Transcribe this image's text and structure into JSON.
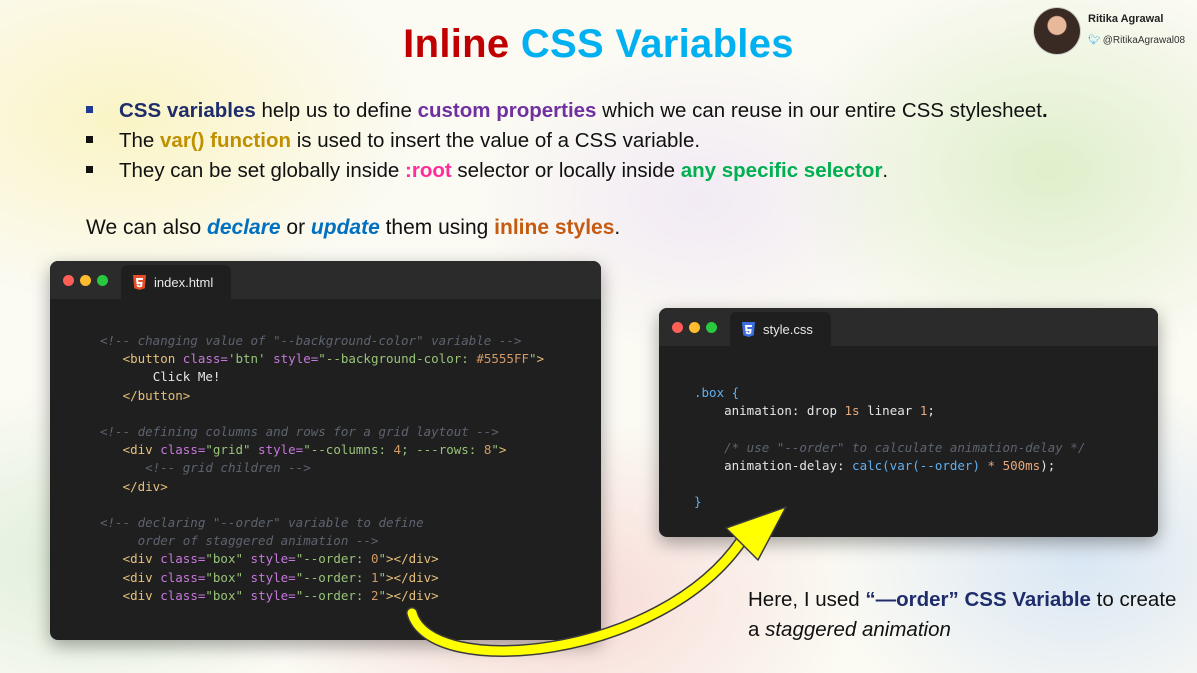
{
  "title": {
    "part1": "Inline",
    "part2": "CSS Variables"
  },
  "author": {
    "name": "Ritika Agrawal",
    "handle": "@RitikaAgrawal08",
    "avatar": "avatar-photo",
    "twitter_icon": "twitter-bird-icon"
  },
  "bullets": [
    {
      "b1": "CSS variables",
      "t1": " help us to define ",
      "b2": "custom properties",
      "t2": " which we can reuse in our entire CSS stylesheet",
      "end": "."
    },
    {
      "t0": "The ",
      "b1": "var() function",
      "t1": " is used to insert the value of a CSS variable."
    },
    {
      "t0": "They can be set globally inside ",
      "b1": ":root",
      "t1": " selector or locally inside ",
      "b2": "any specific selector",
      "t2": "."
    }
  ],
  "intro": {
    "t0": "We can also ",
    "e1": "declare",
    "t1": " or ",
    "e2": "update",
    "t2": " them using ",
    "b1": "inline styles",
    "end": "."
  },
  "html_window": {
    "filename": "index.html",
    "icon": "html5-icon",
    "lines": {
      "c1": "<!-- changing value of \"--background-color\" variable -->",
      "l1a": "<button",
      "l1b": " class=",
      "l1c": "'btn'",
      "l1d": " style=",
      "l1e": "\"--background-color: ",
      "l1f": "#5555FF",
      "l1g": "\"",
      "l1h": ">",
      "l2": "Click Me!",
      "l3": "</button>",
      "c2": "<!-- defining columns and rows for a grid laytout -->",
      "l4a": "<div",
      "l4b": " class=",
      "l4c": "\"grid\"",
      "l4d": " style=",
      "l4e": "\"--columns: ",
      "l4f": "4",
      "l4g": "; ---rows: ",
      "l4h": "8",
      "l4i": "\"",
      "l4j": ">",
      "c3": "<!-- grid children -->",
      "l5": "</div>",
      "c4a": "<!-- declaring \"--order\" variable to define",
      "c4b": "order of staggered animation -->",
      "r0a": "<div",
      "r0b": " class=",
      "r0c": "\"box\"",
      "r0d": " style=",
      "r0e": "\"--order: ",
      "r0f": "0",
      "r0g": "\"",
      "r0h": "></div>",
      "r1a": "<div",
      "r1b": " class=",
      "r1c": "\"box\"",
      "r1d": " style=",
      "r1e": "\"--order: ",
      "r1f": "1",
      "r1g": "\"",
      "r1h": "></div>",
      "r2a": "<div",
      "r2b": " class=",
      "r2c": "\"box\"",
      "r2d": " style=",
      "r2e": "\"--order: ",
      "r2f": "2",
      "r2g": "\"",
      "r2h": "></div>"
    }
  },
  "css_window": {
    "filename": "style.css",
    "icon": "css3-icon",
    "lines": {
      "sel": ".box {",
      "p1a": "animation: drop ",
      "p1b": "1s",
      "p1c": " linear ",
      "p1d": "1",
      "p1e": ";",
      "cm": "/* use \"--order\" to calculate animation-delay */",
      "p2a": "animation-delay: ",
      "p2b": "calc(var(--order)",
      "p2c": " * ",
      "p2d": "500ms",
      "p2e": ");",
      "close": "}"
    }
  },
  "note": {
    "t0": "Here, I used ",
    "b1": "“—order” CSS Variable",
    "t1": " to create a ",
    "e1": "staggered animation"
  },
  "colors": {
    "title_red": "#c00000",
    "title_blue": "#00b0f0",
    "arrow": "#ffff00"
  }
}
